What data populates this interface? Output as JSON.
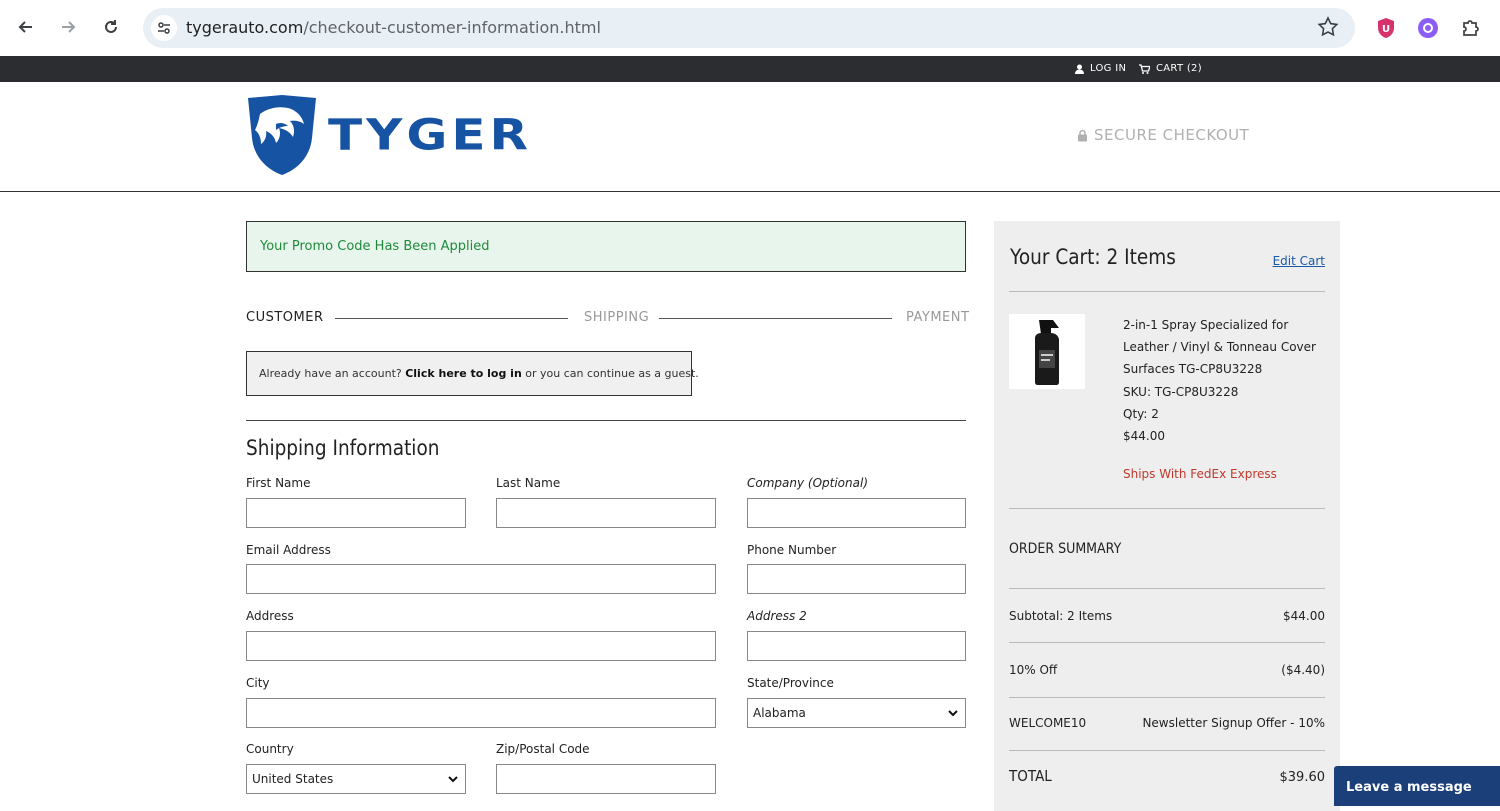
{
  "browser": {
    "url_domain": "tygerauto.com",
    "url_path": "/checkout-customer-information.html"
  },
  "utility_bar": {
    "login": "LOG IN",
    "cart": "CART (2)"
  },
  "header": {
    "logo_text": "TYGER",
    "secure_checkout": "SECURE CHECKOUT"
  },
  "promo_message": "Your Promo Code Has Been Applied",
  "steps": [
    "CUSTOMER",
    "SHIPPING",
    "PAYMENT"
  ],
  "login_box": {
    "prefix": "Already have an account?",
    "link": "Click here to log in",
    "suffix": "or you can continue as a guest."
  },
  "shipping": {
    "title": "Shipping Information",
    "first_name": "First Name",
    "last_name": "Last Name",
    "company": "Company (Optional)",
    "email": "Email Address",
    "phone": "Phone Number",
    "address": "Address",
    "address2": "Address 2",
    "city": "City",
    "state_label": "State/Province",
    "state_value": "Alabama",
    "country_label": "Country",
    "country_value": "United States",
    "zip": "Zip/Postal Code"
  },
  "cart": {
    "title": "Your Cart: 2 Items",
    "edit": "Edit Cart",
    "product_lines": [
      "2-in-1 Spray Specialized for",
      "Leather / Vinyl & Tonneau Cover",
      "Surfaces TG-CP8U3228"
    ],
    "sku": "SKU: TG-CP8U3228",
    "qty": "Qty: 2",
    "price": "$44.00",
    "shipping_note": "Ships With FedEx Express"
  },
  "summary": {
    "title": "ORDER SUMMARY",
    "subtotal_label": "Subtotal: 2 Items",
    "subtotal_value": "$44.00",
    "discount_label": "10% Off",
    "discount_value": "($4.40)",
    "coupon_code": "WELCOME10",
    "coupon_desc": "Newsletter Signup Offer - 10%",
    "total_label": "TOTAL",
    "total_value": "$39.60"
  },
  "chat_label": "Leave a message",
  "colors": {
    "brand_blue": "#1753a3",
    "promo_green": "#1f8a3c",
    "shipping_red": "#c0392b",
    "chat_bg": "#1b3f78"
  }
}
